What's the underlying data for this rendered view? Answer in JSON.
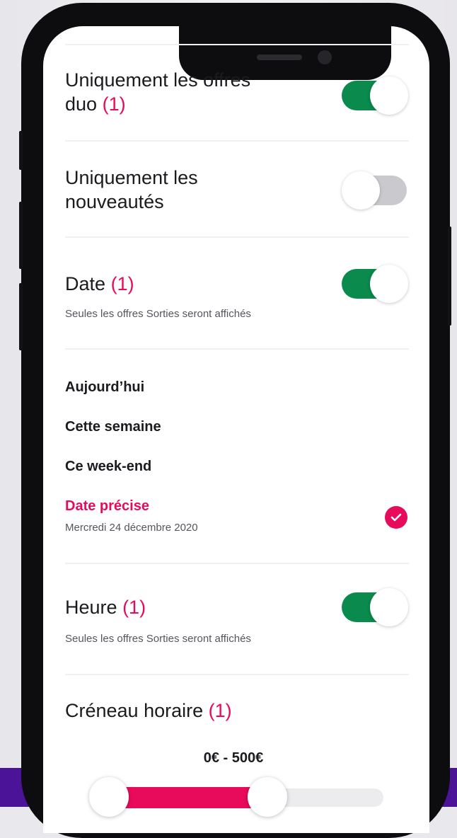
{
  "filters": {
    "duo": {
      "label": "Uniquement les offres",
      "label2": "duo",
      "count": "(1)",
      "enabled": true
    },
    "new": {
      "label": "Uniquement les",
      "label2": "nouveautés",
      "enabled": false
    },
    "date": {
      "label": "Date",
      "count": "(1)",
      "enabled": true,
      "note": "Seules les offres Sorties seront affichés",
      "options": [
        "Aujourd’hui",
        "Cette semaine",
        "Ce week-end",
        "Date précise"
      ],
      "selected": "Date précise",
      "selected_date": "Mercredi 24 décembre 2020"
    },
    "hour": {
      "label": "Heure",
      "count": "(1)",
      "enabled": true,
      "note": "Seules les offres Sorties seront affichés"
    },
    "slot": {
      "label": "Créneau horaire",
      "count": "(1)",
      "range_text": "0€ - 500€",
      "range_min": 0,
      "range_max": 500
    }
  },
  "icons": {
    "check": "check-icon"
  },
  "colors": {
    "accent": "#e80a5b",
    "toggle_on": "#0a8a4c",
    "toggle_off": "#c9c9ce",
    "footer_band": "#4a1398"
  }
}
